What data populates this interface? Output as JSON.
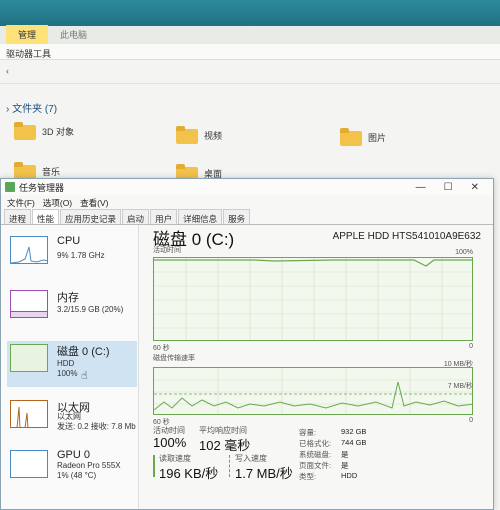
{
  "explorer": {
    "ribbon_tabs": [
      "管理",
      "此电脑"
    ],
    "ribbon_sub": "驱动器工具",
    "folders_header": "文件夹 (7)",
    "folders": [
      "3D 对象",
      "视频",
      "图片",
      "音乐",
      "桌面"
    ]
  },
  "tm": {
    "title": "任务管理器",
    "menu": [
      "文件(F)",
      "选项(O)",
      "查看(V)"
    ],
    "tabs": [
      "进程",
      "性能",
      "应用历史记录",
      "启动",
      "用户",
      "详细信息",
      "服务"
    ],
    "active_tab": "性能",
    "side": [
      {
        "name": "CPU",
        "sub1": "9% 1.78 GHz",
        "sub2": ""
      },
      {
        "name": "内存",
        "sub1": "3.2/15.9 GB (20%)",
        "sub2": ""
      },
      {
        "name": "磁盘 0 (C:)",
        "sub1": "HDD",
        "sub2": "100%"
      },
      {
        "name": "以太网",
        "sub1": "以太网",
        "sub2": "发送: 0.2 接收: 7.8 Mb"
      },
      {
        "name": "GPU 0",
        "sub1": "Radeon Pro 555X",
        "sub2": "1% (48 °C)"
      }
    ],
    "main": {
      "title": "磁盘 0 (C:)",
      "model": "APPLE HDD HTS541010A9E632",
      "graph1_label": "活动时间",
      "graph1_max": "100%",
      "graph1_time": "60 秒",
      "graph1_min": "0",
      "graph2_label": "磁盘传输速率",
      "graph2_max": "10 MB/秒",
      "graph2_mid": "7 MB/秒",
      "graph2_time": "60 秒",
      "graph2_min": "0",
      "stats": {
        "active_label": "活动时间",
        "active_value": "100%",
        "resp_label": "平均响应时间",
        "resp_value": "102 毫秒",
        "read_label": "读取速度",
        "read_value": "196 KB/秒",
        "write_label": "写入速度",
        "write_value": "1.7 MB/秒"
      },
      "props": {
        "capacity_k": "容量:",
        "capacity_v": "932 GB",
        "formatted_k": "已格式化:",
        "formatted_v": "744 GB",
        "system_k": "系统磁盘:",
        "system_v": "是",
        "pagefile_k": "页面文件:",
        "pagefile_v": "是",
        "type_k": "类型:",
        "type_v": "HDD"
      }
    }
  },
  "colors": {
    "disk_green": "#6aa84f",
    "selected_bg": "#cfe3f3"
  }
}
